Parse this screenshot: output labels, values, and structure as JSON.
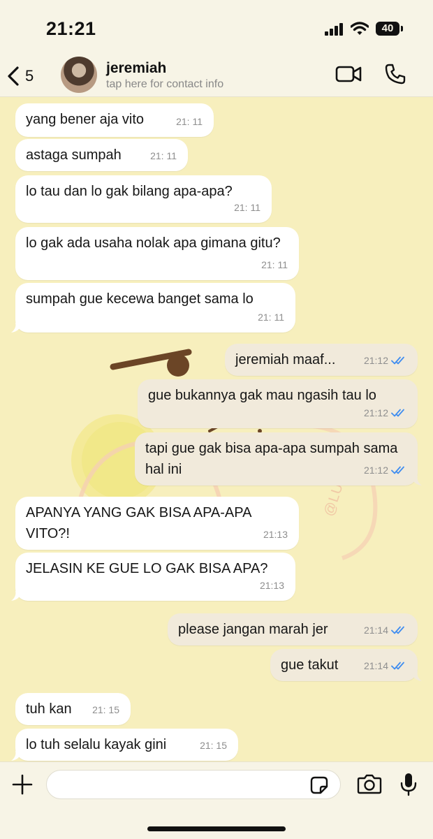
{
  "status_bar": {
    "time": "21:21",
    "battery": "40"
  },
  "header": {
    "back_count": "5",
    "contact_name": "jeremiah",
    "subtitle": "tap here for contact info"
  },
  "messages": [
    {
      "direction": "in",
      "text": "yang bener aja vito",
      "time": "21: 11"
    },
    {
      "direction": "in",
      "text": "astaga sumpah",
      "time": "21: 11"
    },
    {
      "direction": "in",
      "text": "lo tau dan lo gak bilang apa-apa?",
      "time": "21: 11"
    },
    {
      "direction": "in",
      "text": "lo gak ada usaha nolak apa gimana gitu?",
      "time": "21: 11"
    },
    {
      "direction": "in",
      "text": "sumpah gue kecewa banget sama lo",
      "time": "21: 11"
    },
    {
      "direction": "out",
      "text": "jeremiah maaf...",
      "time": "21:12",
      "read": true
    },
    {
      "direction": "out",
      "text": "gue bukannya gak mau ngasih tau lo",
      "time": "21:12",
      "read": true
    },
    {
      "direction": "out",
      "text": "tapi gue gak bisa apa-apa sumpah sama hal ini",
      "time": "21:12",
      "read": true
    },
    {
      "direction": "in",
      "text": "APANYA YANG GAK BISA APA-APA VITO?!",
      "time": "21:13"
    },
    {
      "direction": "in",
      "text": "JELASIN KE GUE LO GAK BISA APA?",
      "time": "21:13"
    },
    {
      "direction": "out",
      "text": "please jangan marah jer",
      "time": "21:14",
      "read": true
    },
    {
      "direction": "out",
      "text": "gue takut",
      "time": "21:14",
      "read": true
    },
    {
      "direction": "in",
      "text": "tuh kan",
      "time": "21: 15"
    },
    {
      "direction": "in",
      "text": "lo tuh selalu kayak gini",
      "time": "21: 15"
    }
  ],
  "wallpaper_watermark": "@LUCKMI",
  "composer": {
    "placeholder": ""
  },
  "icons": {
    "back": "chevron-left-icon",
    "video": "video-camera-icon",
    "call": "phone-icon",
    "plus": "plus-icon",
    "sticker": "sticker-icon",
    "camera": "camera-icon",
    "mic": "microphone-icon",
    "read_receipt": "double-check-icon"
  },
  "colors": {
    "chat_background": "#f7efbd",
    "incoming_bubble": "#ffffff",
    "outgoing_bubble": "#f1eadb",
    "read_tick": "#3f8df0"
  }
}
